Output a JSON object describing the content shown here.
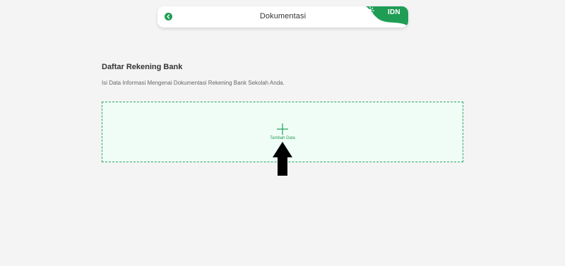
{
  "header": {
    "title": "Dokumentasi",
    "brand_label": "IDN",
    "brand_color": "#1f9d55"
  },
  "section": {
    "title": "Daftar Rekening Bank",
    "description": "Isi Data Informasi Mengenai Dokumentasi Rekening Bank Sekolah Anda."
  },
  "dropzone": {
    "label": "Tambah Data",
    "icon": "plus-icon",
    "accent": "#2aa563"
  },
  "icons": {
    "back": "chevron-left-icon",
    "pointer": "arrow-up-icon"
  }
}
